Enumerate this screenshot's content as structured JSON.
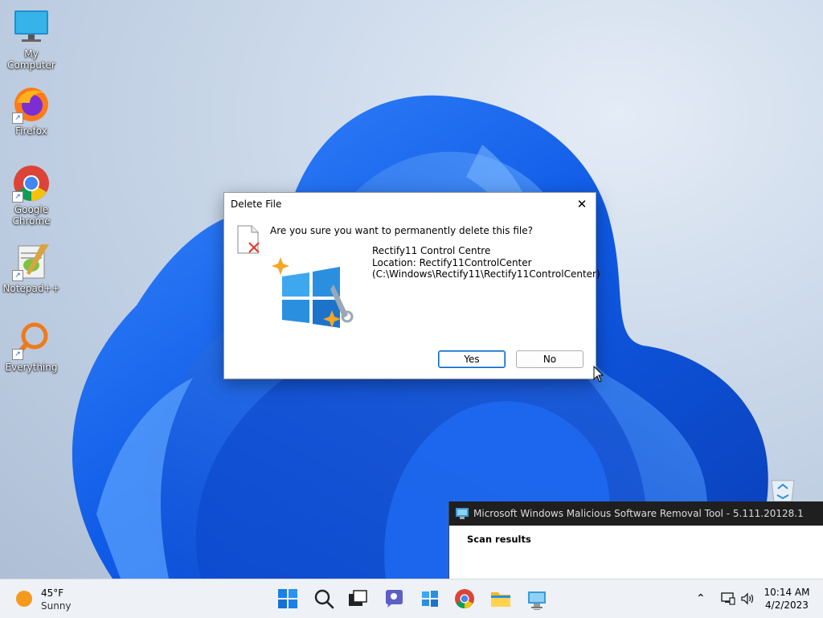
{
  "desktop": {
    "icons": [
      {
        "label": "My Computer",
        "icon": "monitor-icon"
      },
      {
        "label": "Firefox",
        "icon": "firefox-icon"
      },
      {
        "label": "Google Chrome",
        "icon": "chrome-icon"
      },
      {
        "label": "Notepad++",
        "icon": "notepad-plus-plus-icon"
      },
      {
        "label": "Everything",
        "icon": "magnifier-icon"
      }
    ]
  },
  "dialog": {
    "title": "Delete File",
    "close_glyph": "✕",
    "question": "Are you sure you want to permanently delete this file?",
    "file_name": "Rectify11 Control Centre",
    "location": "Location: Rectify11ControlCenter",
    "path": "(C:\\Windows\\Rectify11\\Rectify11ControlCenter)",
    "yes_label": "Yes",
    "no_label": "No"
  },
  "msrt": {
    "title": "Microsoft Windows Malicious Software Removal Tool - 5.111.20128.1",
    "heading": "Scan results"
  },
  "taskbar": {
    "weather": {
      "temp": "45°F",
      "condition": "Sunny"
    },
    "clock": {
      "time": "10:14 AM",
      "date": "4/2/2023"
    },
    "chevron": "⌃"
  },
  "colors": {
    "accent": "#0067c0",
    "wallpaper_bloom": "#1a64e0",
    "taskbar": "#eef1f6"
  }
}
